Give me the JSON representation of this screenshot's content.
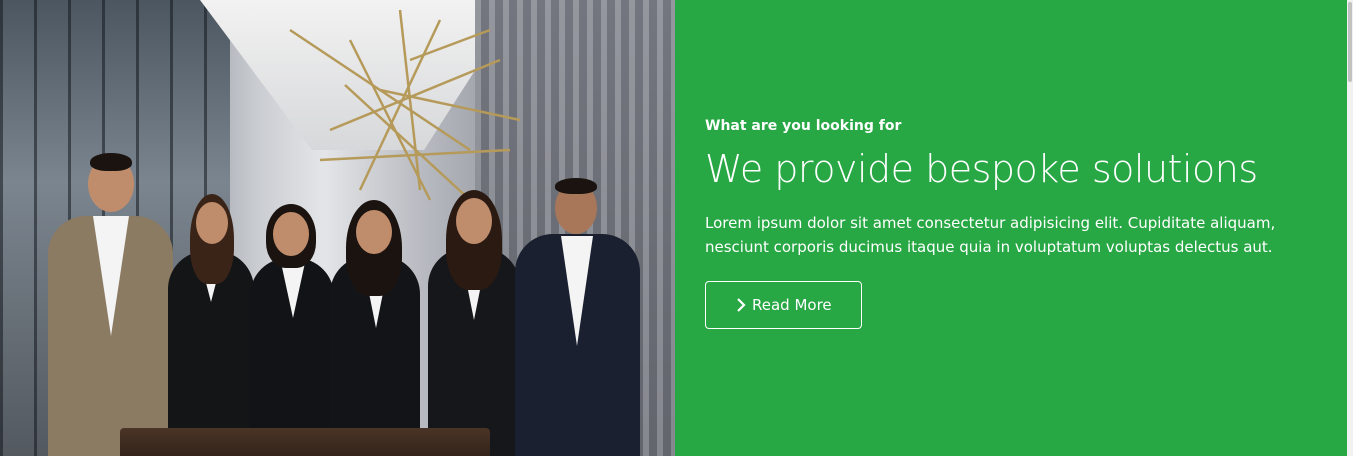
{
  "hero": {
    "image_alt": "Team of six business professionals standing in an office lobby",
    "kicker": "What are you looking for",
    "headline": "We provide bespoke solutions",
    "description": "Lorem ipsum dolor sit amet consectetur adipisicing elit. Cupiditate aliquam, nesciunt corporis ducimus itaque quia in voluptatum voluptas delectus aut.",
    "button_label": "Read More",
    "button_icon": "chevron-right-icon"
  },
  "colors": {
    "panel_bg": "#28a745",
    "text": "#ffffff"
  }
}
